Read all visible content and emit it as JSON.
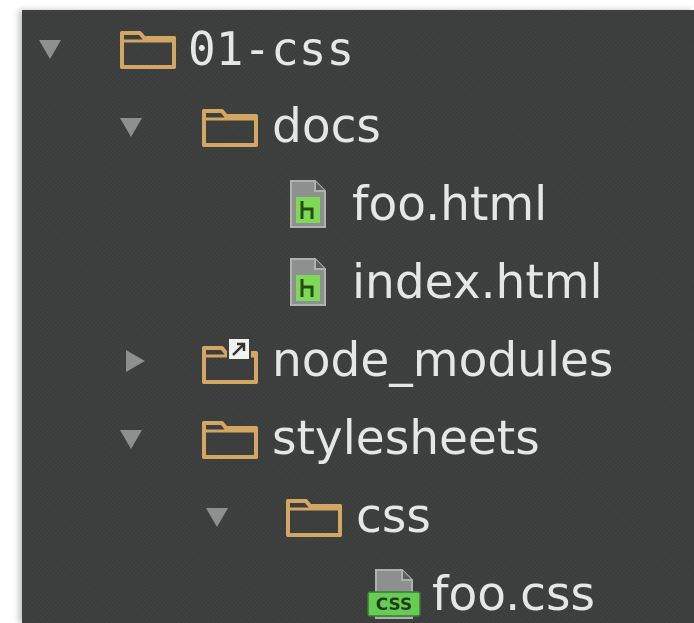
{
  "colors": {
    "panel_bg": "#3d3e3e",
    "folder": "#d3a664",
    "arrow": "#8e8f8f",
    "text": "#e6e6e6",
    "html_file_accent": "#7ed957",
    "css_file_accent": "#66cc55"
  },
  "tree": [
    {
      "label": "01-css",
      "kind": "folder",
      "expanded": true,
      "icon": "folder-icon"
    },
    {
      "label": "docs",
      "kind": "folder",
      "expanded": true,
      "icon": "folder-icon"
    },
    {
      "label": "foo.html",
      "kind": "file",
      "icon": "html-file-icon"
    },
    {
      "label": "index.html",
      "kind": "file",
      "icon": "html-file-icon"
    },
    {
      "label": "node_modules",
      "kind": "folder",
      "expanded": false,
      "icon": "symlink-folder-icon"
    },
    {
      "label": "stylesheets",
      "kind": "folder",
      "expanded": true,
      "icon": "folder-icon"
    },
    {
      "label": "css",
      "kind": "folder",
      "expanded": true,
      "icon": "folder-icon"
    },
    {
      "label": "foo.css",
      "kind": "file",
      "icon": "css-file-icon",
      "badge": "CSS"
    }
  ]
}
